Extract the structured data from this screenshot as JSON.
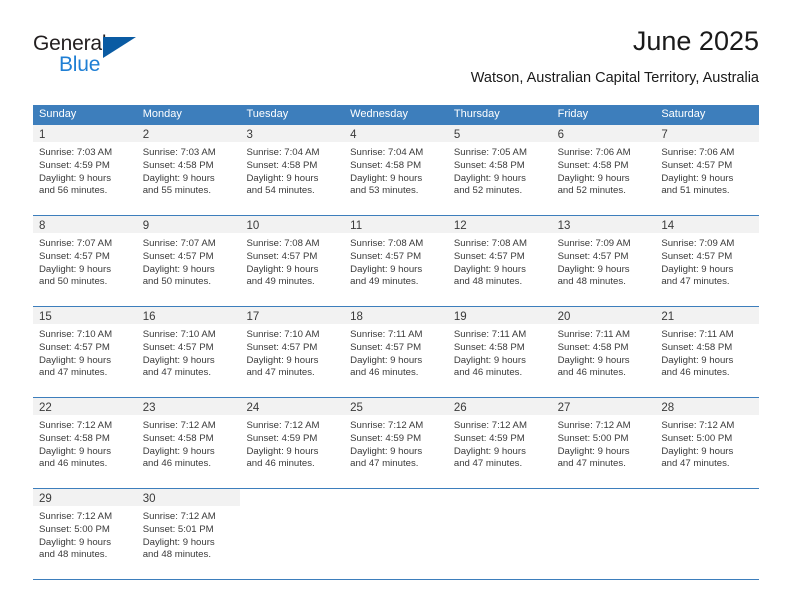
{
  "brand": {
    "name_part1": "General",
    "name_part2": "Blue",
    "triangle_color": "#0a5ba3",
    "blue_color": "#1f7fd4"
  },
  "header": {
    "title": "June 2025",
    "subtitle": "Watson, Australian Capital Territory, Australia",
    "accent_color": "#3d7ebc",
    "daynum_bg": "#f2f2f2"
  },
  "weekdays": [
    "Sunday",
    "Monday",
    "Tuesday",
    "Wednesday",
    "Thursday",
    "Friday",
    "Saturday"
  ],
  "weeks": [
    [
      {
        "day": "1",
        "sunrise": "Sunrise: 7:03 AM",
        "sunset": "Sunset: 4:59 PM",
        "daylight_1": "Daylight: 9 hours",
        "daylight_2": "and 56 minutes."
      },
      {
        "day": "2",
        "sunrise": "Sunrise: 7:03 AM",
        "sunset": "Sunset: 4:58 PM",
        "daylight_1": "Daylight: 9 hours",
        "daylight_2": "and 55 minutes."
      },
      {
        "day": "3",
        "sunrise": "Sunrise: 7:04 AM",
        "sunset": "Sunset: 4:58 PM",
        "daylight_1": "Daylight: 9 hours",
        "daylight_2": "and 54 minutes."
      },
      {
        "day": "4",
        "sunrise": "Sunrise: 7:04 AM",
        "sunset": "Sunset: 4:58 PM",
        "daylight_1": "Daylight: 9 hours",
        "daylight_2": "and 53 minutes."
      },
      {
        "day": "5",
        "sunrise": "Sunrise: 7:05 AM",
        "sunset": "Sunset: 4:58 PM",
        "daylight_1": "Daylight: 9 hours",
        "daylight_2": "and 52 minutes."
      },
      {
        "day": "6",
        "sunrise": "Sunrise: 7:06 AM",
        "sunset": "Sunset: 4:58 PM",
        "daylight_1": "Daylight: 9 hours",
        "daylight_2": "and 52 minutes."
      },
      {
        "day": "7",
        "sunrise": "Sunrise: 7:06 AM",
        "sunset": "Sunset: 4:57 PM",
        "daylight_1": "Daylight: 9 hours",
        "daylight_2": "and 51 minutes."
      }
    ],
    [
      {
        "day": "8",
        "sunrise": "Sunrise: 7:07 AM",
        "sunset": "Sunset: 4:57 PM",
        "daylight_1": "Daylight: 9 hours",
        "daylight_2": "and 50 minutes."
      },
      {
        "day": "9",
        "sunrise": "Sunrise: 7:07 AM",
        "sunset": "Sunset: 4:57 PM",
        "daylight_1": "Daylight: 9 hours",
        "daylight_2": "and 50 minutes."
      },
      {
        "day": "10",
        "sunrise": "Sunrise: 7:08 AM",
        "sunset": "Sunset: 4:57 PM",
        "daylight_1": "Daylight: 9 hours",
        "daylight_2": "and 49 minutes."
      },
      {
        "day": "11",
        "sunrise": "Sunrise: 7:08 AM",
        "sunset": "Sunset: 4:57 PM",
        "daylight_1": "Daylight: 9 hours",
        "daylight_2": "and 49 minutes."
      },
      {
        "day": "12",
        "sunrise": "Sunrise: 7:08 AM",
        "sunset": "Sunset: 4:57 PM",
        "daylight_1": "Daylight: 9 hours",
        "daylight_2": "and 48 minutes."
      },
      {
        "day": "13",
        "sunrise": "Sunrise: 7:09 AM",
        "sunset": "Sunset: 4:57 PM",
        "daylight_1": "Daylight: 9 hours",
        "daylight_2": "and 48 minutes."
      },
      {
        "day": "14",
        "sunrise": "Sunrise: 7:09 AM",
        "sunset": "Sunset: 4:57 PM",
        "daylight_1": "Daylight: 9 hours",
        "daylight_2": "and 47 minutes."
      }
    ],
    [
      {
        "day": "15",
        "sunrise": "Sunrise: 7:10 AM",
        "sunset": "Sunset: 4:57 PM",
        "daylight_1": "Daylight: 9 hours",
        "daylight_2": "and 47 minutes."
      },
      {
        "day": "16",
        "sunrise": "Sunrise: 7:10 AM",
        "sunset": "Sunset: 4:57 PM",
        "daylight_1": "Daylight: 9 hours",
        "daylight_2": "and 47 minutes."
      },
      {
        "day": "17",
        "sunrise": "Sunrise: 7:10 AM",
        "sunset": "Sunset: 4:57 PM",
        "daylight_1": "Daylight: 9 hours",
        "daylight_2": "and 47 minutes."
      },
      {
        "day": "18",
        "sunrise": "Sunrise: 7:11 AM",
        "sunset": "Sunset: 4:57 PM",
        "daylight_1": "Daylight: 9 hours",
        "daylight_2": "and 46 minutes."
      },
      {
        "day": "19",
        "sunrise": "Sunrise: 7:11 AM",
        "sunset": "Sunset: 4:58 PM",
        "daylight_1": "Daylight: 9 hours",
        "daylight_2": "and 46 minutes."
      },
      {
        "day": "20",
        "sunrise": "Sunrise: 7:11 AM",
        "sunset": "Sunset: 4:58 PM",
        "daylight_1": "Daylight: 9 hours",
        "daylight_2": "and 46 minutes."
      },
      {
        "day": "21",
        "sunrise": "Sunrise: 7:11 AM",
        "sunset": "Sunset: 4:58 PM",
        "daylight_1": "Daylight: 9 hours",
        "daylight_2": "and 46 minutes."
      }
    ],
    [
      {
        "day": "22",
        "sunrise": "Sunrise: 7:12 AM",
        "sunset": "Sunset: 4:58 PM",
        "daylight_1": "Daylight: 9 hours",
        "daylight_2": "and 46 minutes."
      },
      {
        "day": "23",
        "sunrise": "Sunrise: 7:12 AM",
        "sunset": "Sunset: 4:58 PM",
        "daylight_1": "Daylight: 9 hours",
        "daylight_2": "and 46 minutes."
      },
      {
        "day": "24",
        "sunrise": "Sunrise: 7:12 AM",
        "sunset": "Sunset: 4:59 PM",
        "daylight_1": "Daylight: 9 hours",
        "daylight_2": "and 46 minutes."
      },
      {
        "day": "25",
        "sunrise": "Sunrise: 7:12 AM",
        "sunset": "Sunset: 4:59 PM",
        "daylight_1": "Daylight: 9 hours",
        "daylight_2": "and 47 minutes."
      },
      {
        "day": "26",
        "sunrise": "Sunrise: 7:12 AM",
        "sunset": "Sunset: 4:59 PM",
        "daylight_1": "Daylight: 9 hours",
        "daylight_2": "and 47 minutes."
      },
      {
        "day": "27",
        "sunrise": "Sunrise: 7:12 AM",
        "sunset": "Sunset: 5:00 PM",
        "daylight_1": "Daylight: 9 hours",
        "daylight_2": "and 47 minutes."
      },
      {
        "day": "28",
        "sunrise": "Sunrise: 7:12 AM",
        "sunset": "Sunset: 5:00 PM",
        "daylight_1": "Daylight: 9 hours",
        "daylight_2": "and 47 minutes."
      }
    ],
    [
      {
        "day": "29",
        "sunrise": "Sunrise: 7:12 AM",
        "sunset": "Sunset: 5:00 PM",
        "daylight_1": "Daylight: 9 hours",
        "daylight_2": "and 48 minutes."
      },
      {
        "day": "30",
        "sunrise": "Sunrise: 7:12 AM",
        "sunset": "Sunset: 5:01 PM",
        "daylight_1": "Daylight: 9 hours",
        "daylight_2": "and 48 minutes."
      },
      {
        "day": "",
        "sunrise": "",
        "sunset": "",
        "daylight_1": "",
        "daylight_2": ""
      },
      {
        "day": "",
        "sunrise": "",
        "sunset": "",
        "daylight_1": "",
        "daylight_2": ""
      },
      {
        "day": "",
        "sunrise": "",
        "sunset": "",
        "daylight_1": "",
        "daylight_2": ""
      },
      {
        "day": "",
        "sunrise": "",
        "sunset": "",
        "daylight_1": "",
        "daylight_2": ""
      },
      {
        "day": "",
        "sunrise": "",
        "sunset": "",
        "daylight_1": "",
        "daylight_2": ""
      }
    ]
  ]
}
